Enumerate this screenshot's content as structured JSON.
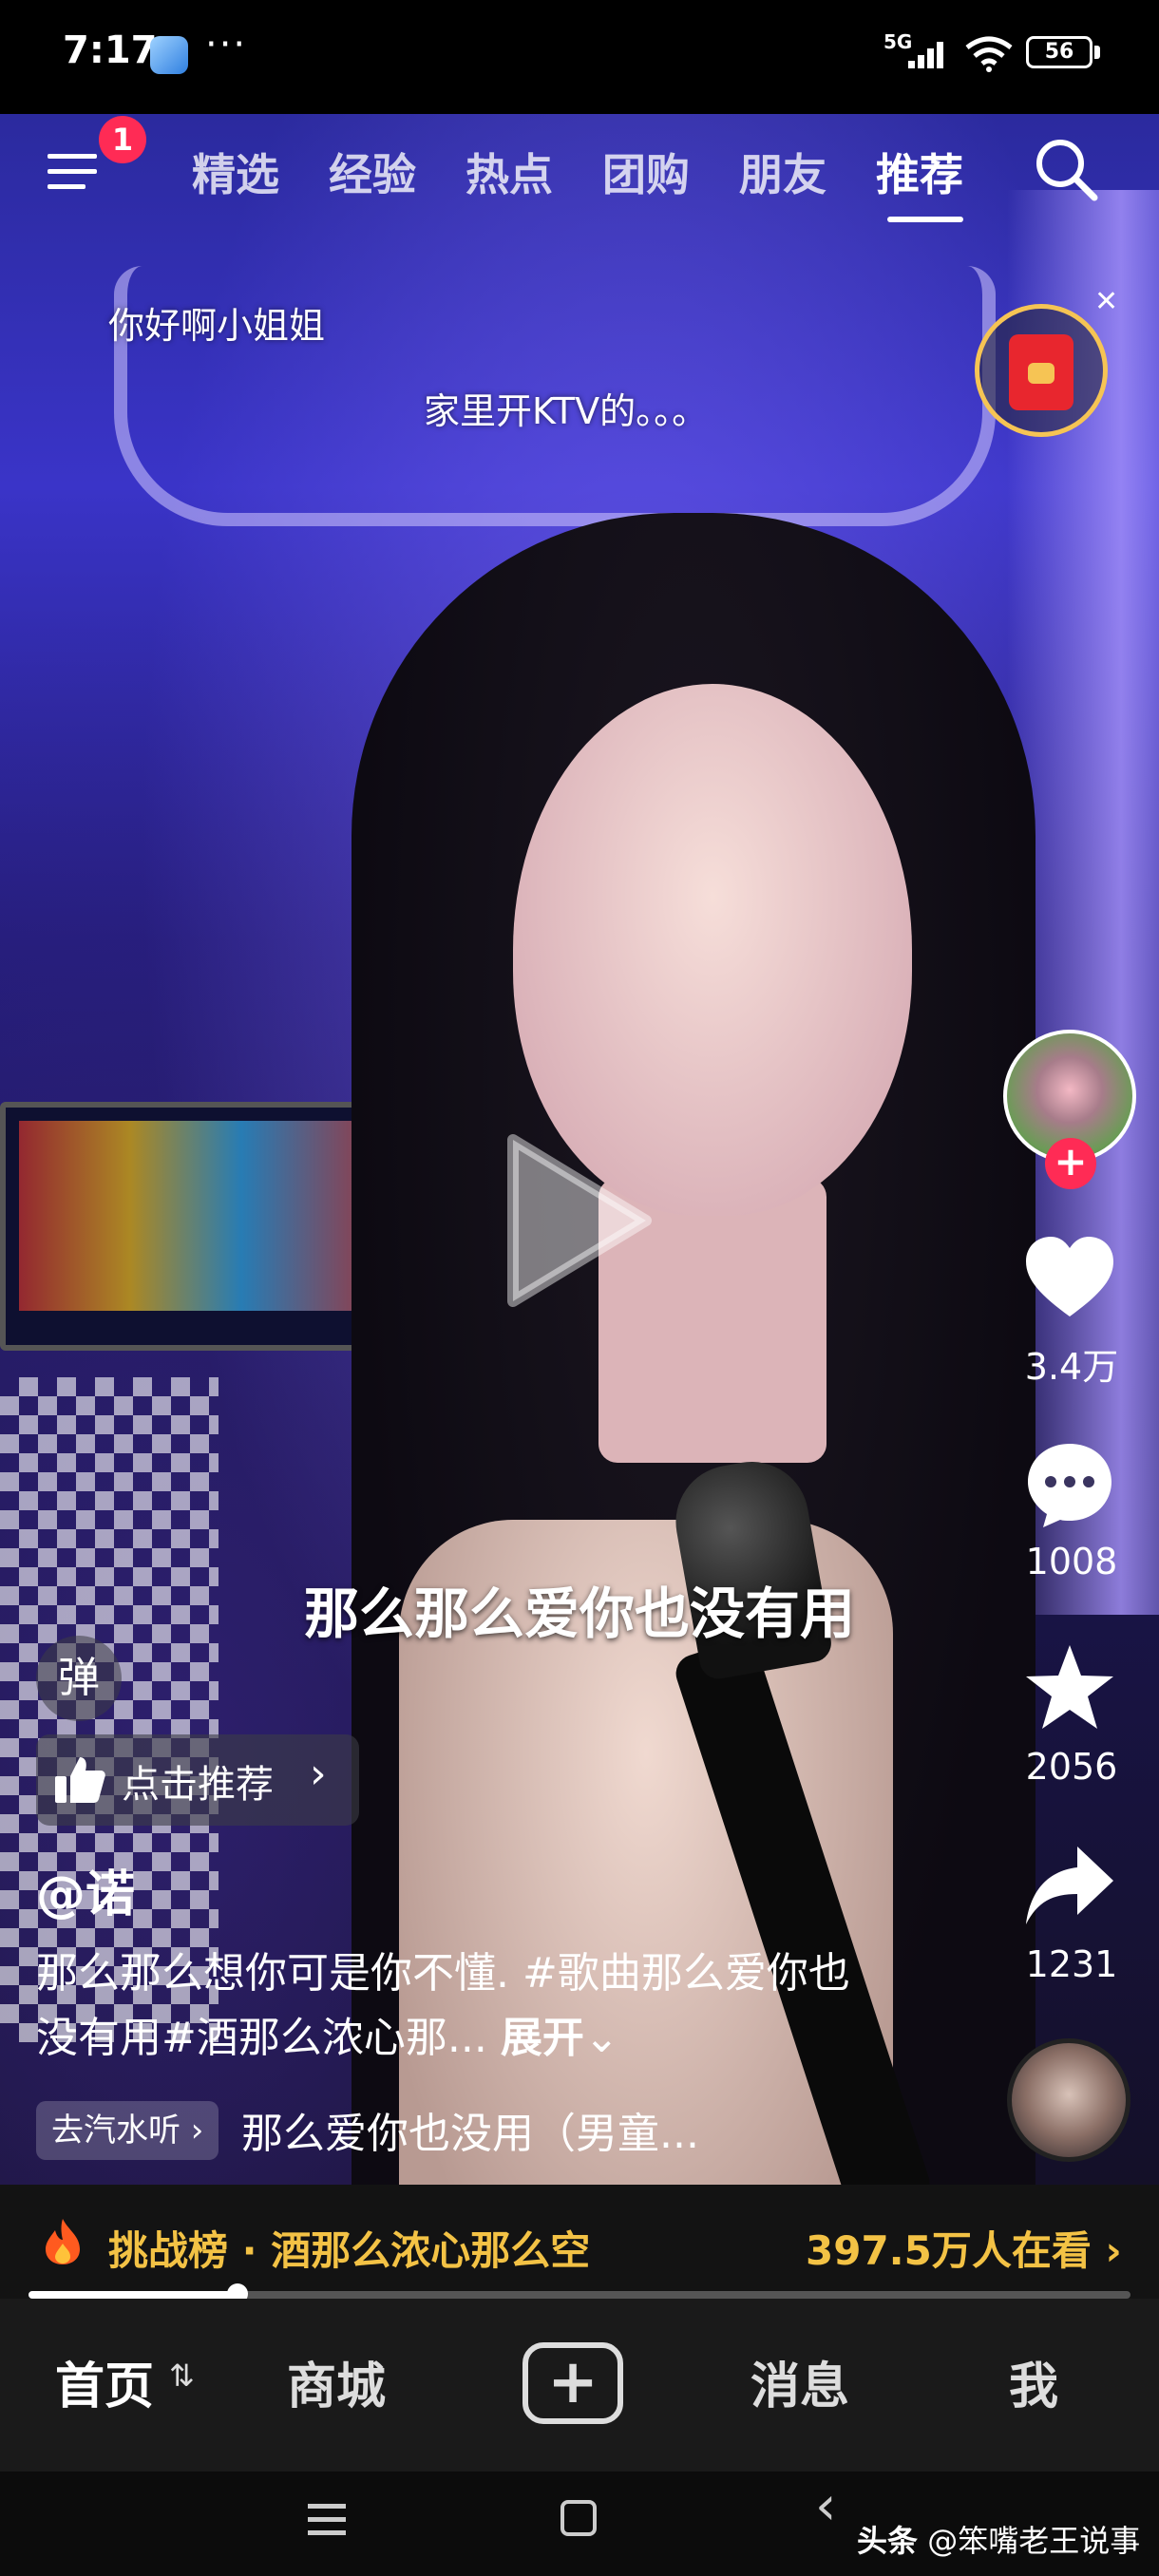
{
  "status": {
    "time": "7:17",
    "network": "5G",
    "battery": "56"
  },
  "top_nav": {
    "badge": "1",
    "tabs": [
      {
        "label": "精选"
      },
      {
        "label": "经验"
      },
      {
        "label": "热点"
      },
      {
        "label": "团购"
      },
      {
        "label": "朋友"
      },
      {
        "label": "推荐"
      }
    ],
    "active_tab": "推荐"
  },
  "danmu": [
    "你好啊小姐姐",
    "家里开KTV的。。。"
  ],
  "lyrics": "那么那么爱你也没有用",
  "rail": {
    "likes": "3.4万",
    "comments": "1008",
    "favorites": "2056",
    "shares": "1231"
  },
  "danmu_toggle": "弹",
  "recommend_label": "点击推荐",
  "author": "@诺",
  "description": "那么那么想你可是你不懂. #歌曲那么爱你也没有用#酒那么浓心那...",
  "expand_label": "展开",
  "music": {
    "tag": "去汽水听",
    "title": "那么爱你也没用（男童..."
  },
  "challenge": {
    "text": "挑战榜 · 酒那么浓心那么空",
    "watching": "397.5万人在看"
  },
  "progress": {
    "fraction": 0.19
  },
  "bottom_nav": {
    "home": "首页",
    "mall": "商城",
    "messages": "消息",
    "me": "我"
  },
  "watermark": {
    "prefix": "头条",
    "handle": "@笨嘴老王说事"
  },
  "colors": {
    "accent_red": "#ff2b55",
    "challenge_gold": "#f3c245"
  }
}
